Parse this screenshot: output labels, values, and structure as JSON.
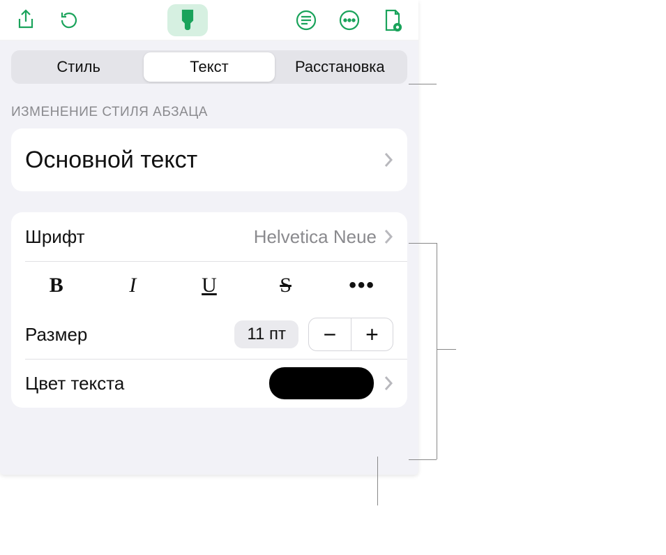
{
  "toolbar": {
    "share": "share-icon",
    "undo": "undo-icon",
    "format": "brush-icon",
    "insert": "list-icon",
    "more": "more-icon",
    "document": "document-icon"
  },
  "tabs": {
    "style": "Стиль",
    "text": "Текст",
    "arrange": "Расстановка"
  },
  "section_title": "ИЗМЕНЕНИЕ СТИЛЯ АБЗАЦА",
  "paragraph_style": "Основной текст",
  "font": {
    "label": "Шрифт",
    "value": "Helvetica Neue",
    "bold": "B",
    "italic": "I",
    "underline": "U",
    "strike": "S",
    "more": "•••"
  },
  "size": {
    "label": "Размер",
    "value": "11 пт",
    "minus": "−",
    "plus": "+"
  },
  "text_color": {
    "label": "Цвет текста",
    "value": "#000000"
  }
}
